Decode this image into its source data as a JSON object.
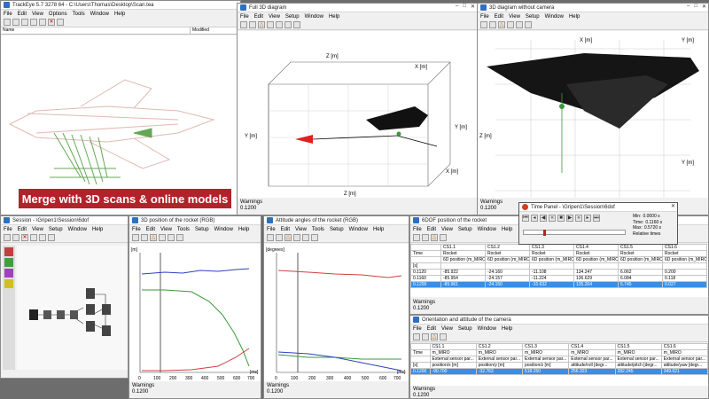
{
  "main": {
    "title": "TrackEye 5.7 3278 64 - C:\\Users\\Thomas\\Desktop\\Scan.tea",
    "menu": [
      "File",
      "Edit",
      "View",
      "Options",
      "Tools",
      "Window",
      "Help"
    ],
    "columns": [
      "Name",
      "Modified"
    ],
    "banner": "Merge with 3D scans & online models"
  },
  "full3d": {
    "title": "Full 3D diagram",
    "menu": [
      "File",
      "Edit",
      "View",
      "Setup",
      "Window",
      "Help"
    ],
    "axis_labels": [
      "Z [m]",
      "X [m]",
      "Y [m]",
      "Y [m]",
      "X [m]",
      "Z [m]"
    ],
    "warnings": "Warnings",
    "time": "0.1200"
  },
  "nocam": {
    "title": "3D diagram without camera",
    "menu": [
      "File",
      "Edit",
      "View",
      "Setup",
      "Window",
      "Help"
    ],
    "axis_labels": [
      "X [m]",
      "Y [m]",
      "Z [m]",
      "Y [m]"
    ],
    "warnings": "Warnings",
    "time": "0.1200"
  },
  "session": {
    "title": "Session - \\Gripen1\\Session\\6dof",
    "menu": [
      "File",
      "Edit",
      "View",
      "Setup",
      "Window",
      "Help"
    ]
  },
  "pos3d": {
    "title": "3D position of the rocket (RGB)",
    "menu": [
      "File",
      "Edit",
      "View",
      "Tools",
      "Setup",
      "Window",
      "Help"
    ],
    "ylabel": "[m]",
    "xlabel": "[ms]",
    "xticks": [
      "0",
      "100",
      "200",
      "300",
      "400",
      "500",
      "600",
      "700"
    ],
    "warnings": "Warnings",
    "time": "0.1200"
  },
  "attitude": {
    "title": "Attitude angles of the rocket (RGB)",
    "menu": [
      "File",
      "Edit",
      "View",
      "Tools",
      "Setup",
      "Window",
      "Help"
    ],
    "ylabel": "[degrees]",
    "xlabel": "[ms]",
    "xticks": [
      "0",
      "100",
      "200",
      "300",
      "400",
      "500",
      "600",
      "700"
    ],
    "warnings": "Warnings",
    "time": "0.1200"
  },
  "sixdof": {
    "title": "6DOF position of the rocket",
    "menu": [
      "File",
      "Edit",
      "View",
      "Setup",
      "Window",
      "Help"
    ],
    "header": [
      "",
      "CS1.1",
      "CS1.2",
      "CS1.3",
      "CS1.4",
      "CS1.5",
      "CS1.6"
    ],
    "sub1": [
      "Time",
      "Rocket",
      "Rocket",
      "Rocket",
      "Rocket",
      "Rocket",
      "Rocket"
    ],
    "sub2": [
      "",
      "6D position (m_MIRO) pos/x [cm]",
      "6D position (m_MIRO) pos/y [cm]",
      "6D position (m_MIRO) pos/z [cm]",
      "6D position (m_MIRO) attitude/roll [degrees]",
      "6D position (m_MIRO) attitude/pitch [degrees]",
      "6D position (m_MIRO) attitude/yaw [degrees]"
    ],
    "unit": [
      "[s]",
      "",
      "",
      "",
      "",
      "",
      ""
    ],
    "rows": [
      [
        "0.1120",
        "-85.922",
        "-24.160",
        "-11.108",
        "134.247",
        "6.062",
        "0.200"
      ],
      [
        "0.1160",
        "-85.954",
        "-24.157",
        "-11.224",
        "136.629",
        "6.084",
        "0.118"
      ],
      [
        "0.1200",
        "-85.961",
        "-24.150",
        "-10.632",
        "135.204",
        "5.745",
        "0.027"
      ]
    ],
    "warnings": "Warnings",
    "time": "0.1200"
  },
  "timepanel": {
    "title": "Time Panel - \\Gripen1\\Session\\6dof",
    "min_label": "Min:",
    "min_val": "0.0000 s",
    "time_label": "Time:",
    "time_val": "0.1160 s",
    "max_label": "Max:",
    "max_val": "0.5720 s",
    "relative": "Relative times"
  },
  "orient": {
    "title": "Orientation and attitude of the camera",
    "menu": [
      "File",
      "Edit",
      "View",
      "Setup",
      "Window",
      "Help"
    ],
    "header": [
      "",
      "CS1.1",
      "CS1.2",
      "CS1.3",
      "CS1.4",
      "CS1.5",
      "CS1.6"
    ],
    "sub1": [
      "Time",
      "m_MIRO",
      "m_MIRO",
      "m_MIRO",
      "m_MIRO",
      "m_MIRO",
      "m_MIRO"
    ],
    "sub2": [
      "",
      "External sensor par...",
      "External sensor par...",
      "External sensor par...",
      "External sensor par...",
      "External sensor par...",
      "External sensor par..."
    ],
    "sub3": [
      "[s]",
      "position/x [m]",
      "position/y [m]",
      "position/z [m]",
      "attitude/roll [degr...",
      "attitude/pitch [degr...",
      "attitude/yaw [degr..."
    ],
    "rows": [
      [
        "0.1200",
        "-90.700",
        "-32.763",
        "518.250",
        "256.323",
        "282.245",
        "349.021"
      ]
    ],
    "warnings": "Warnings",
    "time": "0.1200"
  },
  "colors": {
    "accent_red": "#b2222a",
    "selection": "#3a8ee6",
    "series_red": "#d04040",
    "series_green": "#3a9a3a",
    "series_blue": "#3040c0"
  }
}
